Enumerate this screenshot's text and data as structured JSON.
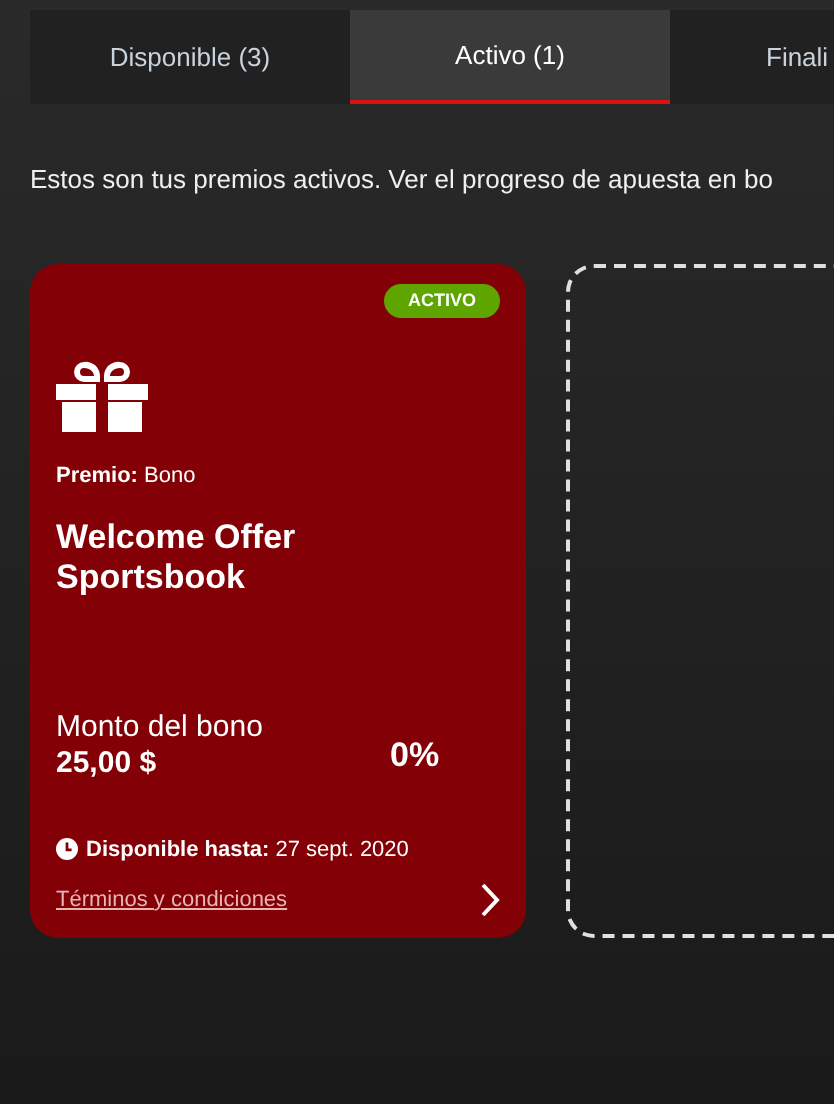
{
  "tabs": [
    {
      "label": "Disponible (3)",
      "selected": false
    },
    {
      "label": "Activo (1)",
      "selected": true
    },
    {
      "label": "Finali",
      "selected": false
    }
  ],
  "intro": "Estos son tus premios activos. Ver el progreso de apuesta en bo",
  "rewards": [
    {
      "active": true,
      "badge": "ACTIVO",
      "prize": "**Premio:** Bono",
      "title": "Welcome Offer Sportsbook",
      "amount_label": "Monto del bono",
      "amount": "25,00 $",
      "progress": "0%",
      "expiry": "**Disponible hasta:** 27 sept. 2020",
      "terms_link": "Términos y condiciones"
    }
  ]
}
